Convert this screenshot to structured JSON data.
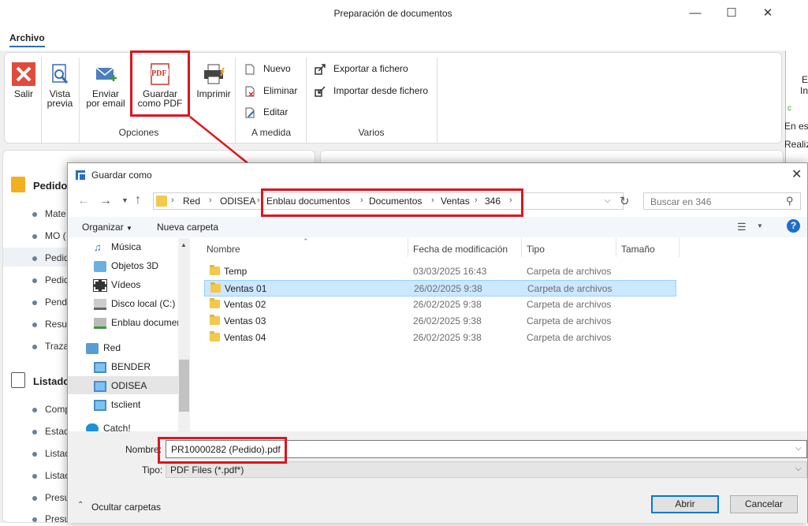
{
  "app": {
    "title": "Preparación de documentos",
    "tab": "Archivo",
    "ribbon": {
      "salir": "Salir",
      "vista_previa": [
        "Vista",
        "previa"
      ],
      "enviar": [
        "Enviar",
        "por email"
      ],
      "guardar_pdf": [
        "Guardar",
        "como PDF"
      ],
      "imprimir": "Imprimir",
      "nuevo": "Nuevo",
      "eliminar": "Eliminar",
      "editar": "Editar",
      "exportar": "Exportar a fichero",
      "importar": "Importar desde fichero",
      "group_opciones": "Opciones",
      "group_medida": "A medida",
      "group_varios": "Varios",
      "pdf_badge": "PDF"
    },
    "left_panel": {
      "section1": "Pedido",
      "items1": [
        "Mate",
        "MO (",
        "Pedid",
        "Pedid",
        "Pend",
        "Resu",
        "Traza"
      ],
      "section2": "Listado",
      "items2": [
        "Comp",
        "Estad",
        "Listad",
        "Listad",
        "Presu",
        "Presu"
      ]
    },
    "right_strip": [
      "E",
      "In",
      "c",
      "En esp",
      "Realiz"
    ]
  },
  "dialog": {
    "title": "Guardar como",
    "breadcrumb": [
      "Red",
      "ODISEA",
      "Enblau documentos",
      "Documentos",
      "Ventas",
      "346"
    ],
    "search_placeholder": "Buscar en 346",
    "organizar": "Organizar",
    "nueva_carpeta": "Nueva carpeta",
    "help": "?",
    "nav": [
      {
        "label": "Música",
        "icon": "music-icon"
      },
      {
        "label": "Objetos 3D",
        "icon": "cube-icon"
      },
      {
        "label": "Vídeos",
        "icon": "video-icon"
      },
      {
        "label": "Disco local (C:)",
        "icon": "drive-icon"
      },
      {
        "label": "Enblau documer",
        "icon": "network-drive-icon"
      },
      {
        "label": "Red",
        "icon": "network-icon"
      },
      {
        "label": "BENDER",
        "icon": "computer-icon"
      },
      {
        "label": "ODISEA",
        "icon": "computer-icon"
      },
      {
        "label": "tsclient",
        "icon": "computer-icon"
      },
      {
        "label": "Catch!",
        "icon": "app-icon"
      }
    ],
    "columns": {
      "name": "Nombre",
      "date": "Fecha de modificación",
      "type": "Tipo",
      "size": "Tamaño"
    },
    "files": [
      {
        "name": "Temp",
        "date": "03/03/2025 16:43",
        "type": "Carpeta de archivos"
      },
      {
        "name": "Ventas 01",
        "date": "26/02/2025 9:38",
        "type": "Carpeta de archivos"
      },
      {
        "name": "Ventas 02",
        "date": "26/02/2025 9:38",
        "type": "Carpeta de archivos"
      },
      {
        "name": "Ventas 03",
        "date": "26/02/2025 9:38",
        "type": "Carpeta de archivos"
      },
      {
        "name": "Ventas 04",
        "date": "26/02/2025 9:38",
        "type": "Carpeta de archivos"
      }
    ],
    "selected_row": 1,
    "filename_label": "Nombre:",
    "filename_value": "PR10000282 (Pedido).pdf",
    "type_label": "Tipo:",
    "type_value": "PDF Files (*.pdf*)",
    "hide_folders": "Ocultar carpetas",
    "open_button": "Abrir",
    "cancel_button": "Cancelar"
  },
  "colors": {
    "highlight": "#e0141e",
    "accent": "#2a6ebb",
    "selection": "#cce8ff"
  }
}
